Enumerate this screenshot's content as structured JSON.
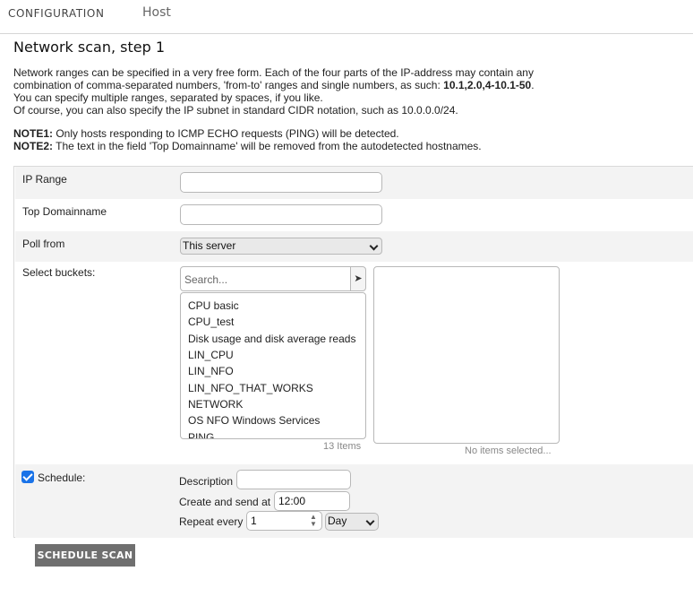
{
  "topbar": {
    "section": "CONFIGURATION",
    "tab": "Host"
  },
  "page_title": "Network scan, step 1",
  "description": {
    "line1": "Network ranges can be specified in a very free form. Each of the four parts of the IP-address may contain any",
    "line2_pre": "combination of comma-separated numbers, 'from-to' ranges and single numbers, as such: ",
    "line2_bold": "10.1,2.0,4-10.1-50",
    "line2_post": ".",
    "line3": "You can specify multiple ranges, separated by spaces, if you like.",
    "line4": "Of course, you can also specify the IP subnet in standard CIDR notation, such as 10.0.0.0/24."
  },
  "notes": {
    "note1_label": "NOTE1:",
    "note1_text": " Only hosts responding to ICMP ECHO requests (PING) will be detected.",
    "note2_label": "NOTE2:",
    "note2_text": " The text in the field 'Top Domainname' will be removed from the autodetected hostnames."
  },
  "form": {
    "ip_range_label": "IP Range",
    "ip_range_value": "",
    "top_domain_label": "Top Domainname",
    "top_domain_value": "",
    "poll_from_label": "Poll from",
    "poll_from_value": "This server",
    "buckets_label": "Select buckets:",
    "search_placeholder": "Search...",
    "search_go_icon": "arrow-right-icon",
    "bucket_items": [
      "CPU basic",
      "CPU_test",
      "Disk usage and disk average reads",
      "LIN_CPU",
      "LIN_NFO",
      "LIN_NFO_THAT_WORKS",
      "NETWORK",
      "OS NFO Windows Services",
      "PING"
    ],
    "bucket_count": "13 Items",
    "no_items_selected": "No items selected...",
    "schedule_label": "Schedule:",
    "schedule_checked": true,
    "description_label": "Description",
    "description_value": "",
    "create_send_label": "Create and send at",
    "create_send_value": "12:00",
    "repeat_label": "Repeat every",
    "repeat_value": "1",
    "repeat_unit": "Day"
  },
  "actions": {
    "schedule_scan": "SCHEDULE SCAN"
  }
}
